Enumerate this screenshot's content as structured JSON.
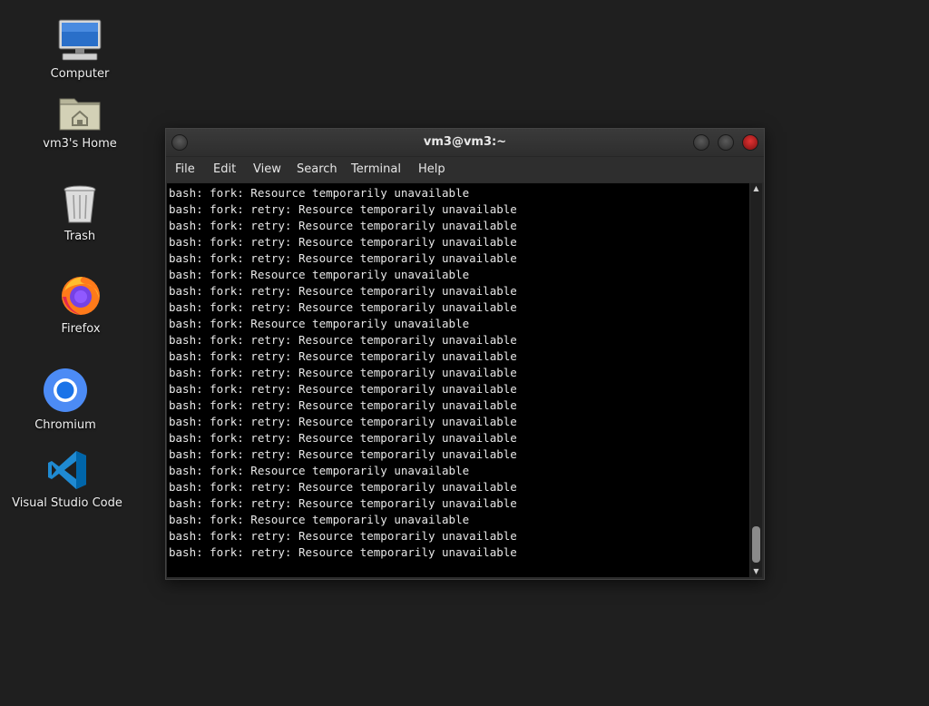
{
  "desktop": {
    "icons": [
      {
        "label": "Computer",
        "icon": "computer-icon"
      },
      {
        "label": "vm3's Home",
        "icon": "home-folder-icon"
      },
      {
        "label": "Trash",
        "icon": "trash-icon"
      },
      {
        "label": "Firefox",
        "icon": "firefox-icon"
      },
      {
        "label": "Chromium",
        "icon": "chromium-icon"
      },
      {
        "label": "Visual Studio Code",
        "icon": "vscode-icon"
      }
    ]
  },
  "terminal": {
    "title": "vm3@vm3:~",
    "menu": [
      "File",
      "Edit",
      "View",
      "Search",
      "Terminal",
      "Help"
    ],
    "lines": [
      "bash: fork: Resource temporarily unavailable",
      "bash: fork: retry: Resource temporarily unavailable",
      "bash: fork: retry: Resource temporarily unavailable",
      "bash: fork: retry: Resource temporarily unavailable",
      "bash: fork: retry: Resource temporarily unavailable",
      "bash: fork: Resource temporarily unavailable",
      "bash: fork: retry: Resource temporarily unavailable",
      "bash: fork: retry: Resource temporarily unavailable",
      "bash: fork: Resource temporarily unavailable",
      "bash: fork: retry: Resource temporarily unavailable",
      "bash: fork: retry: Resource temporarily unavailable",
      "bash: fork: retry: Resource temporarily unavailable",
      "bash: fork: retry: Resource temporarily unavailable",
      "bash: fork: retry: Resource temporarily unavailable",
      "bash: fork: retry: Resource temporarily unavailable",
      "bash: fork: retry: Resource temporarily unavailable",
      "bash: fork: retry: Resource temporarily unavailable",
      "bash: fork: Resource temporarily unavailable",
      "bash: fork: retry: Resource temporarily unavailable",
      "bash: fork: retry: Resource temporarily unavailable",
      "bash: fork: Resource temporarily unavailable",
      "bash: fork: retry: Resource temporarily unavailable",
      "bash: fork: retry: Resource temporarily unavailable"
    ]
  },
  "colors": {
    "desktop_bg": "#1f1f1f",
    "terminal_bg": "#000000",
    "terminal_fg": "#e8e8e8",
    "close_button": "#e23333"
  }
}
